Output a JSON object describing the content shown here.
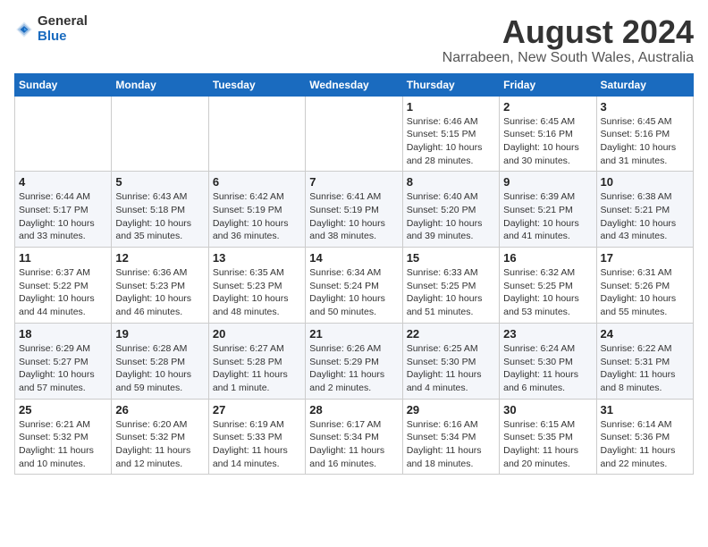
{
  "header": {
    "logo_general": "General",
    "logo_blue": "Blue",
    "month_year": "August 2024",
    "location": "Narrabeen, New South Wales, Australia"
  },
  "weekdays": [
    "Sunday",
    "Monday",
    "Tuesday",
    "Wednesday",
    "Thursday",
    "Friday",
    "Saturday"
  ],
  "weeks": [
    [
      {
        "day": "",
        "info": ""
      },
      {
        "day": "",
        "info": ""
      },
      {
        "day": "",
        "info": ""
      },
      {
        "day": "",
        "info": ""
      },
      {
        "day": "1",
        "info": "Sunrise: 6:46 AM\nSunset: 5:15 PM\nDaylight: 10 hours\nand 28 minutes."
      },
      {
        "day": "2",
        "info": "Sunrise: 6:45 AM\nSunset: 5:16 PM\nDaylight: 10 hours\nand 30 minutes."
      },
      {
        "day": "3",
        "info": "Sunrise: 6:45 AM\nSunset: 5:16 PM\nDaylight: 10 hours\nand 31 minutes."
      }
    ],
    [
      {
        "day": "4",
        "info": "Sunrise: 6:44 AM\nSunset: 5:17 PM\nDaylight: 10 hours\nand 33 minutes."
      },
      {
        "day": "5",
        "info": "Sunrise: 6:43 AM\nSunset: 5:18 PM\nDaylight: 10 hours\nand 35 minutes."
      },
      {
        "day": "6",
        "info": "Sunrise: 6:42 AM\nSunset: 5:19 PM\nDaylight: 10 hours\nand 36 minutes."
      },
      {
        "day": "7",
        "info": "Sunrise: 6:41 AM\nSunset: 5:19 PM\nDaylight: 10 hours\nand 38 minutes."
      },
      {
        "day": "8",
        "info": "Sunrise: 6:40 AM\nSunset: 5:20 PM\nDaylight: 10 hours\nand 39 minutes."
      },
      {
        "day": "9",
        "info": "Sunrise: 6:39 AM\nSunset: 5:21 PM\nDaylight: 10 hours\nand 41 minutes."
      },
      {
        "day": "10",
        "info": "Sunrise: 6:38 AM\nSunset: 5:21 PM\nDaylight: 10 hours\nand 43 minutes."
      }
    ],
    [
      {
        "day": "11",
        "info": "Sunrise: 6:37 AM\nSunset: 5:22 PM\nDaylight: 10 hours\nand 44 minutes."
      },
      {
        "day": "12",
        "info": "Sunrise: 6:36 AM\nSunset: 5:23 PM\nDaylight: 10 hours\nand 46 minutes."
      },
      {
        "day": "13",
        "info": "Sunrise: 6:35 AM\nSunset: 5:23 PM\nDaylight: 10 hours\nand 48 minutes."
      },
      {
        "day": "14",
        "info": "Sunrise: 6:34 AM\nSunset: 5:24 PM\nDaylight: 10 hours\nand 50 minutes."
      },
      {
        "day": "15",
        "info": "Sunrise: 6:33 AM\nSunset: 5:25 PM\nDaylight: 10 hours\nand 51 minutes."
      },
      {
        "day": "16",
        "info": "Sunrise: 6:32 AM\nSunset: 5:25 PM\nDaylight: 10 hours\nand 53 minutes."
      },
      {
        "day": "17",
        "info": "Sunrise: 6:31 AM\nSunset: 5:26 PM\nDaylight: 10 hours\nand 55 minutes."
      }
    ],
    [
      {
        "day": "18",
        "info": "Sunrise: 6:29 AM\nSunset: 5:27 PM\nDaylight: 10 hours\nand 57 minutes."
      },
      {
        "day": "19",
        "info": "Sunrise: 6:28 AM\nSunset: 5:28 PM\nDaylight: 10 hours\nand 59 minutes."
      },
      {
        "day": "20",
        "info": "Sunrise: 6:27 AM\nSunset: 5:28 PM\nDaylight: 11 hours\nand 1 minute."
      },
      {
        "day": "21",
        "info": "Sunrise: 6:26 AM\nSunset: 5:29 PM\nDaylight: 11 hours\nand 2 minutes."
      },
      {
        "day": "22",
        "info": "Sunrise: 6:25 AM\nSunset: 5:30 PM\nDaylight: 11 hours\nand 4 minutes."
      },
      {
        "day": "23",
        "info": "Sunrise: 6:24 AM\nSunset: 5:30 PM\nDaylight: 11 hours\nand 6 minutes."
      },
      {
        "day": "24",
        "info": "Sunrise: 6:22 AM\nSunset: 5:31 PM\nDaylight: 11 hours\nand 8 minutes."
      }
    ],
    [
      {
        "day": "25",
        "info": "Sunrise: 6:21 AM\nSunset: 5:32 PM\nDaylight: 11 hours\nand 10 minutes."
      },
      {
        "day": "26",
        "info": "Sunrise: 6:20 AM\nSunset: 5:32 PM\nDaylight: 11 hours\nand 12 minutes."
      },
      {
        "day": "27",
        "info": "Sunrise: 6:19 AM\nSunset: 5:33 PM\nDaylight: 11 hours\nand 14 minutes."
      },
      {
        "day": "28",
        "info": "Sunrise: 6:17 AM\nSunset: 5:34 PM\nDaylight: 11 hours\nand 16 minutes."
      },
      {
        "day": "29",
        "info": "Sunrise: 6:16 AM\nSunset: 5:34 PM\nDaylight: 11 hours\nand 18 minutes."
      },
      {
        "day": "30",
        "info": "Sunrise: 6:15 AM\nSunset: 5:35 PM\nDaylight: 11 hours\nand 20 minutes."
      },
      {
        "day": "31",
        "info": "Sunrise: 6:14 AM\nSunset: 5:36 PM\nDaylight: 11 hours\nand 22 minutes."
      }
    ]
  ]
}
